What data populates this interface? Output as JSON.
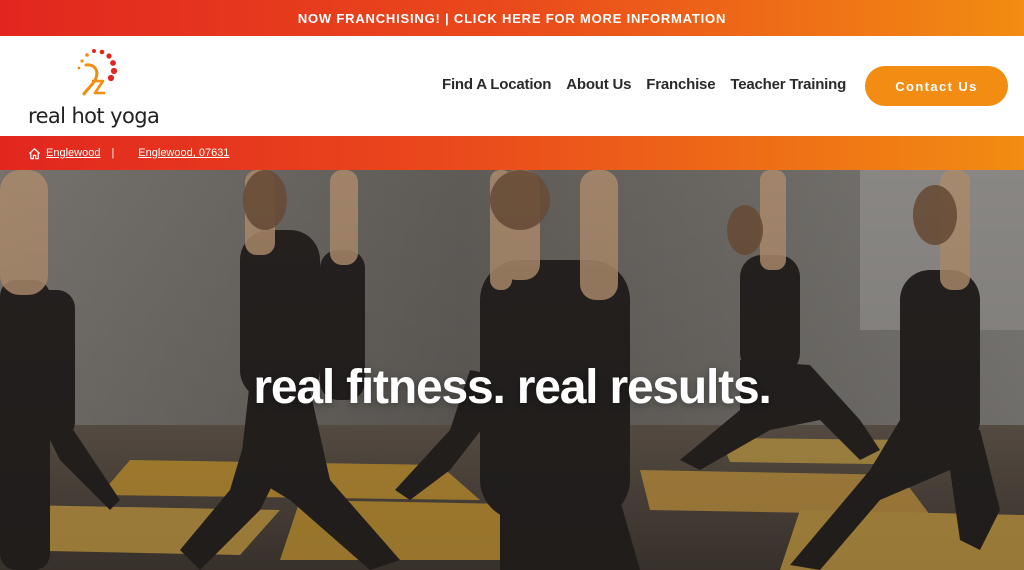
{
  "promo": {
    "text": "NOW FRANCHISING! | CLICK HERE FOR MORE INFORMATION"
  },
  "brand": {
    "name": "real hot yoga"
  },
  "nav": {
    "items": [
      {
        "label": "Find A Location"
      },
      {
        "label": "About Us"
      },
      {
        "label": "Franchise"
      },
      {
        "label": "Teacher Training"
      }
    ],
    "contact_label": "Contact Us"
  },
  "breadcrumb": {
    "home_icon": "home-icon",
    "studio": "Englewood",
    "separator": "|",
    "address": "Englewood, 07631"
  },
  "hero": {
    "title": "real fitness. real results."
  },
  "colors": {
    "brand_red": "#e2261f",
    "brand_orange": "#f28c12",
    "nav_text": "#2a2a2a",
    "mat_yellow": "#d6a83c"
  }
}
